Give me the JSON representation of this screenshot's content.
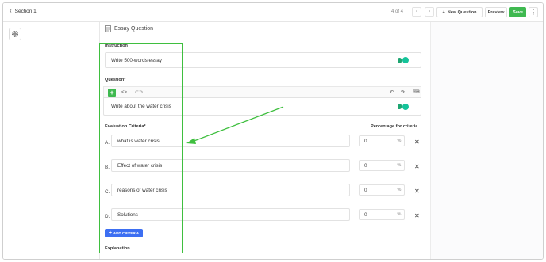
{
  "header": {
    "back_label": "Section 1",
    "pager": "4 of 4",
    "new_question": "New Question",
    "preview": "Preview",
    "save": "Save"
  },
  "question": {
    "title": "Essay Question",
    "instruction_label": "Instruction",
    "instruction_value": "Write 500-words essay",
    "question_label": "Question*",
    "question_value": "Write about the water crisis"
  },
  "criteria": {
    "label": "Evaluation Criteria*",
    "percent_header": "Percentage for criteria",
    "items": [
      {
        "letter": "A.",
        "text": "what is water crisis",
        "percent": "0",
        "unit": "%"
      },
      {
        "letter": "B.",
        "text": "Effect of water crisis",
        "percent": "0",
        "unit": "%"
      },
      {
        "letter": "C.",
        "text": "reasons of water crisis",
        "percent": "0",
        "unit": "%"
      },
      {
        "letter": "D.",
        "text": "Solutions",
        "percent": "0",
        "unit": "%"
      }
    ],
    "add_label": "ADD CRITERIA"
  },
  "explanation_label": "Explanation",
  "colors": {
    "accent_green": "#3fb950",
    "accent_blue": "#3d6ff2",
    "annotation": "#3fbf3f"
  }
}
